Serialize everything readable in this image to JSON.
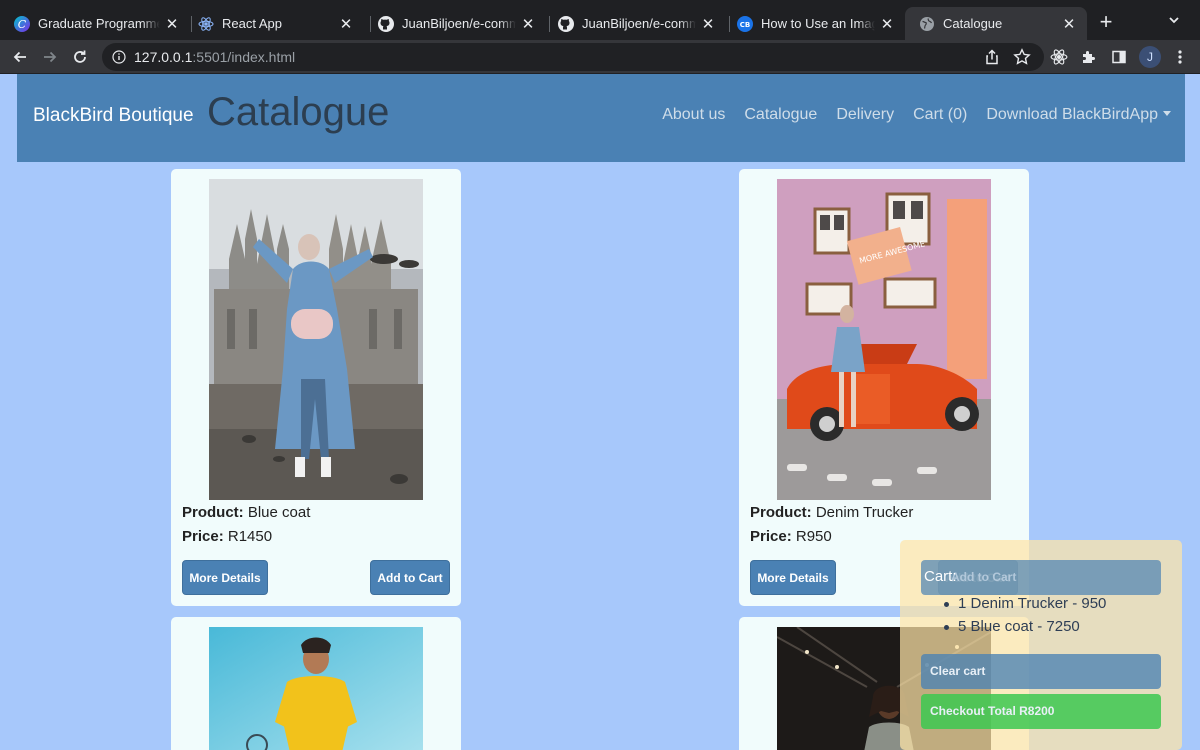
{
  "browser": {
    "tabs": [
      {
        "title": "Graduate Programme - ",
        "icon": "canva-icon",
        "active": false
      },
      {
        "title": "React App",
        "icon": "react-icon",
        "active": false
      },
      {
        "title": "JuanBiljoen/e-commerce",
        "icon": "github-icon",
        "active": false
      },
      {
        "title": "JuanBiljoen/e-commerce",
        "icon": "github-icon",
        "active": false
      },
      {
        "title": "How to Use an Image as",
        "icon": "codebeautify-icon",
        "active": false
      },
      {
        "title": "Catalogue",
        "icon": "globe-icon",
        "active": true
      }
    ],
    "url_host": "127.0.0.1",
    "url_rest": ":5501/index.html",
    "profile_initial": "J"
  },
  "site": {
    "brand": "BlackBird Boutique",
    "page_title": "Catalogue",
    "nav": {
      "about": "About us",
      "catalogue": "Catalogue",
      "delivery": "Delivery",
      "cart": "Cart (0)",
      "download": "Download BlackBirdApp"
    }
  },
  "products": [
    {
      "product_label": "Product:",
      "name": "Blue coat",
      "price_label": "Price:",
      "price": "R1450",
      "details_label": "More Details",
      "add_label": "Add to Cart"
    },
    {
      "product_label": "Product:",
      "name": "Denim Trucker",
      "price_label": "Price:",
      "price": "R950",
      "details_label": "More Details",
      "add_label": "Add to Cart"
    }
  ],
  "cart": {
    "title": "Cart:",
    "items": [
      "1 Denim Trucker - 950",
      "5 Blue coat - 7250"
    ],
    "clear_label": "Clear cart",
    "checkout_label": "Checkout Total R8200"
  },
  "colors": {
    "page_bg": "#a7c8fb",
    "nav_bg": "#4a81b4",
    "card_bg": "#f1fcfc",
    "button_bg": "#4a81b4",
    "checkout_bg": "#50c860"
  }
}
